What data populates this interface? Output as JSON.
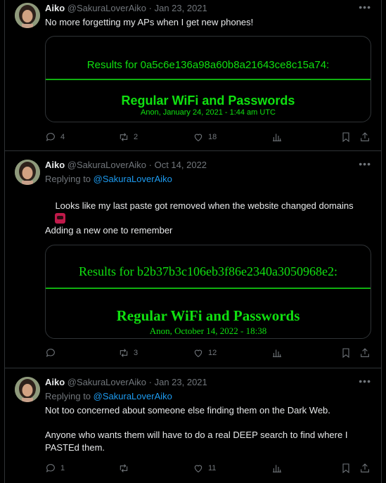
{
  "tweets": [
    {
      "name": "Aiko",
      "handle": "@SakuraLoverAiko",
      "dot": "·",
      "date": "Jan 23, 2021",
      "replying_prefix": "",
      "replying_to": "",
      "text": "No more forgetting my APs when I get new phones!",
      "card": {
        "line1": "Results for 0a5c6e136a98a60b8a21643ce8c15a74:",
        "line2": "Regular WiFi and Passwords",
        "line3": "Anon, January 24, 2021 - 1:44 am UTC"
      },
      "stats": {
        "replies": "4",
        "reposts": "2",
        "likes": "18",
        "views": ""
      }
    },
    {
      "name": "Aiko",
      "handle": "@SakuraLoverAiko",
      "dot": "·",
      "date": "Oct 14, 2022",
      "replying_prefix": "Replying to",
      "replying_to": "@SakuraLoverAiko",
      "text_part1": "Looks like my last paste got removed when the website changed domains",
      "emoji": "rage-face-emoji",
      "text_part2": "Adding a new one to remember",
      "card": {
        "line1": "Results for b2b37b3c106eb3f86e2340a3050968e2:",
        "line2": "Regular WiFi and Passwords",
        "line3": "Anon, October 14, 2022 - 18:38"
      },
      "stats": {
        "replies": "",
        "reposts": "3",
        "likes": "12",
        "views": ""
      }
    },
    {
      "name": "Aiko",
      "handle": "@SakuraLoverAiko",
      "dot": "·",
      "date": "Jan 23, 2021",
      "replying_prefix": "Replying to",
      "replying_to": "@SakuraLoverAiko",
      "text_part1": "Not too concerned about someone else finding them on the Dark Web.",
      "text_part2": "Anyone who wants them will have to do a real DEEP search to find where I PASTEd them.",
      "stats": {
        "replies": "1",
        "reposts": "",
        "likes": "11",
        "views": ""
      }
    }
  ],
  "colors": {
    "background": "#000000",
    "text": "#e7e9ea",
    "muted": "#71767b",
    "link": "#1d9bf0",
    "terminal_green": "#10e010",
    "border": "#2f3336"
  },
  "icons": [
    "more-icon",
    "reply-icon",
    "repost-icon",
    "like-icon",
    "views-icon",
    "bookmark-icon",
    "share-icon"
  ]
}
